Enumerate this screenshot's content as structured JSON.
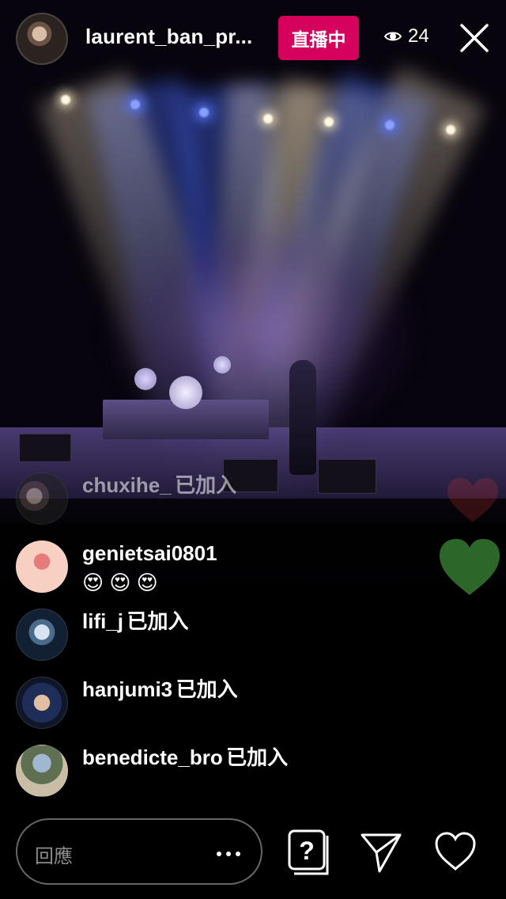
{
  "header": {
    "host_username": "laurent_ban_pr...",
    "live_label": "直播中",
    "viewer_count": "24"
  },
  "comments": [
    {
      "username": "chuxihe_",
      "suffix": "已加入",
      "message": ""
    },
    {
      "username": "genietsai0801",
      "suffix": "",
      "message": "😍 😍 😍"
    },
    {
      "username": "lifi_j",
      "suffix": "已加入",
      "message": ""
    },
    {
      "username": "hanjumi3",
      "suffix": "已加入",
      "message": ""
    },
    {
      "username": "benedicte_bro",
      "suffix": "已加入",
      "message": ""
    }
  ],
  "footer": {
    "reply_placeholder": "回應"
  },
  "icons": {
    "viewers": "eye-icon",
    "close": "close-icon",
    "more": "more-dots-icon",
    "question": "question-icon",
    "send": "send-icon",
    "like": "heart-icon"
  },
  "colors": {
    "live_badge": "#d6005d",
    "green_heart": "#2f6b2b",
    "background": "#000000"
  }
}
